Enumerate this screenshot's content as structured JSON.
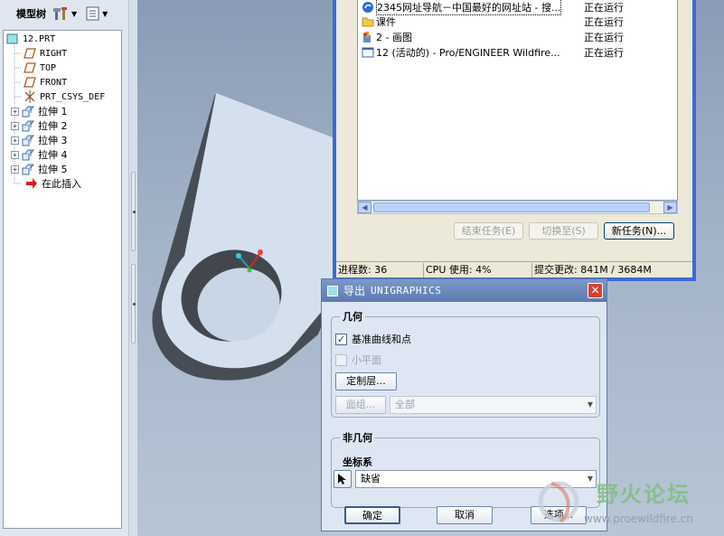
{
  "model_tree": {
    "title": "模型树",
    "items": [
      {
        "label": "12.PRT",
        "icon": "part-icon"
      },
      {
        "label": "RIGHT",
        "icon": "datum-plane-icon"
      },
      {
        "label": "TOP",
        "icon": "datum-plane-icon"
      },
      {
        "label": "FRONT",
        "icon": "datum-plane-icon"
      },
      {
        "label": "PRT_CSYS_DEF",
        "icon": "csys-icon"
      },
      {
        "label": "拉伸 1",
        "icon": "extrude-icon"
      },
      {
        "label": "拉伸 2",
        "icon": "extrude-icon"
      },
      {
        "label": "拉伸 3",
        "icon": "extrude-icon"
      },
      {
        "label": "拉伸 4",
        "icon": "extrude-icon"
      },
      {
        "label": "拉伸 5",
        "icon": "extrude-icon"
      },
      {
        "label": "在此插入",
        "icon": "insert-arrow-icon"
      }
    ]
  },
  "task_manager": {
    "tasks": [
      {
        "name": "2345网址导航－中国最好的网址站 - 搜...",
        "status": "正在运行",
        "icon": "browser-icon"
      },
      {
        "name": "课件",
        "status": "正在运行",
        "icon": "folder-icon"
      },
      {
        "name": "2 - 画图",
        "status": "正在运行",
        "icon": "paint-icon"
      },
      {
        "name": "12 (活动的) - Pro/ENGINEER Wildfire...",
        "status": "正在运行",
        "icon": "window-icon"
      }
    ],
    "buttons": {
      "end_task": "结束任务(E)",
      "switch_to": "切换至(S)",
      "new_task": "新任务(N)..."
    },
    "status": {
      "processes": "进程数: 36",
      "cpu": "CPU 使用: 4%",
      "commit": "提交更改: 841M / 3684M"
    }
  },
  "export_dialog": {
    "title_prefix": "导出",
    "title_name": "UNIGRAPHICS",
    "geometry_group": "几何",
    "datum_curves_label": "基准曲线和点",
    "datum_curves_checked": true,
    "small_plane_label": "小平面",
    "small_plane_checked": false,
    "custom_layer_button": "定制层...",
    "face_group_button": "面组...",
    "face_group_value": "全部",
    "non_geometry_group": "非几何",
    "csys_group": "坐标系",
    "csys_value": "缺省",
    "ok_button": "确定",
    "cancel_button": "取消",
    "options_button": "选项..."
  },
  "watermark": {
    "site_name": "野火论坛",
    "url": "www.proewildfire.cn"
  },
  "colors": {
    "dialog_title": "#6b86b9",
    "close_button": "#d9432f",
    "model_face": "#d5e0ee",
    "model_side": "#474d55",
    "xp_title": "#3a6ad9"
  }
}
